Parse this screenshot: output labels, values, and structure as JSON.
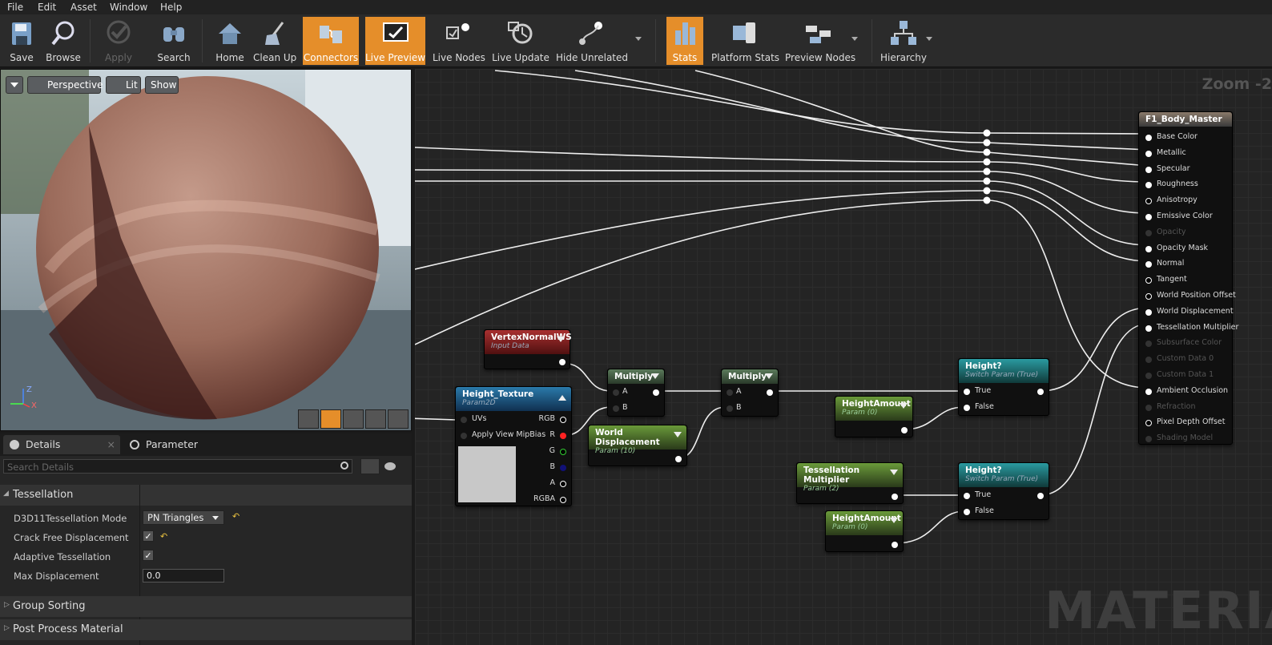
{
  "menu": [
    "File",
    "Edit",
    "Asset",
    "Window",
    "Help"
  ],
  "toolbar": {
    "save": "Save",
    "browse": "Browse",
    "apply": "Apply",
    "search": "Search",
    "home": "Home",
    "clean_up": "Clean Up",
    "connectors": "Connectors",
    "live_preview": "Live Preview",
    "live_nodes": "Live Nodes",
    "live_update": "Live Update",
    "hide_unrelated": "Hide Unrelated",
    "stats": "Stats",
    "platform_stats": "Platform Stats",
    "preview_nodes": "Preview Nodes",
    "hierarchy": "Hierarchy"
  },
  "viewport": {
    "perspective": "Perspective",
    "lit": "Lit",
    "show": "Show",
    "axis_z": "Z",
    "axis_x": "X"
  },
  "details": {
    "tab_details": "Details",
    "tab_param_defaults": "Parameter Defaults",
    "search_placeholder": "Search Details",
    "cat_tessellation": "Tessellation",
    "prop_mode": "D3D11Tessellation Mode",
    "prop_mode_value": "PN Triangles",
    "prop_crack": "Crack Free Displacement",
    "prop_adaptive": "Adaptive Tessellation",
    "prop_maxdisp": "Max Displacement",
    "prop_maxdisp_value": "0.0",
    "cat_group_sorting": "Group Sorting",
    "cat_post_process": "Post Process Material"
  },
  "graph": {
    "zoom": "Zoom -2",
    "watermark": "MATERIAL",
    "result_node": {
      "title": "F1_Body_Master",
      "pins": [
        {
          "label": "Base Color",
          "state": "connected"
        },
        {
          "label": "Metallic",
          "state": "connected"
        },
        {
          "label": "Specular",
          "state": "connected"
        },
        {
          "label": "Roughness",
          "state": "connected"
        },
        {
          "label": "Anisotropy",
          "state": "open"
        },
        {
          "label": "Emissive Color",
          "state": "connected"
        },
        {
          "label": "Opacity",
          "state": "disabled"
        },
        {
          "label": "Opacity Mask",
          "state": "connected"
        },
        {
          "label": "Normal",
          "state": "connected"
        },
        {
          "label": "Tangent",
          "state": "open"
        },
        {
          "label": "World Position Offset",
          "state": "open"
        },
        {
          "label": "World Displacement",
          "state": "connected"
        },
        {
          "label": "Tessellation Multiplier",
          "state": "connected"
        },
        {
          "label": "Subsurface Color",
          "state": "disabled"
        },
        {
          "label": "Custom Data 0",
          "state": "disabled"
        },
        {
          "label": "Custom Data 1",
          "state": "disabled"
        },
        {
          "label": "Ambient Occlusion",
          "state": "connected"
        },
        {
          "label": "Refraction",
          "state": "disabled"
        },
        {
          "label": "Pixel Depth Offset",
          "state": "open"
        },
        {
          "label": "Shading Model",
          "state": "disabled"
        }
      ]
    },
    "vertex_normal": {
      "title": "VertexNormalWS",
      "sub": "Input Data"
    },
    "height_texture": {
      "title": "Height_Texture",
      "sub": "Param2D",
      "uvs": "UVs",
      "mipbias": "Apply View MipBias",
      "rgb": "RGB",
      "r": "R",
      "g": "G",
      "b": "B",
      "a": "A",
      "rgba": "RGBA"
    },
    "multiply1": {
      "title": "Multiply",
      "a": "A",
      "b": "B"
    },
    "multiply2": {
      "title": "Multiply",
      "a": "A",
      "b": "B"
    },
    "world_disp": {
      "title": "World Displacement",
      "sub": "Param (10)"
    },
    "height_amount1": {
      "title": "HeightAmount",
      "sub": "Param (0)"
    },
    "tess_mult": {
      "title": "Tessellation Multiplier",
      "sub": "Param (2)"
    },
    "height_amount2": {
      "title": "HeightAmount",
      "sub": "Param (0)"
    },
    "switch1": {
      "title": "Height?",
      "sub": "Switch Param (True)",
      "true": "True",
      "false": "False"
    },
    "switch2": {
      "title": "Height?",
      "sub": "Switch Param (True)",
      "true": "True",
      "false": "False"
    }
  },
  "colors": {
    "accent": "#e58e2a",
    "param_green": "#5a7a2a",
    "texture_blue": "#1d5a80",
    "switch_teal": "#1c7a80",
    "input_red": "#8a1d1d"
  }
}
